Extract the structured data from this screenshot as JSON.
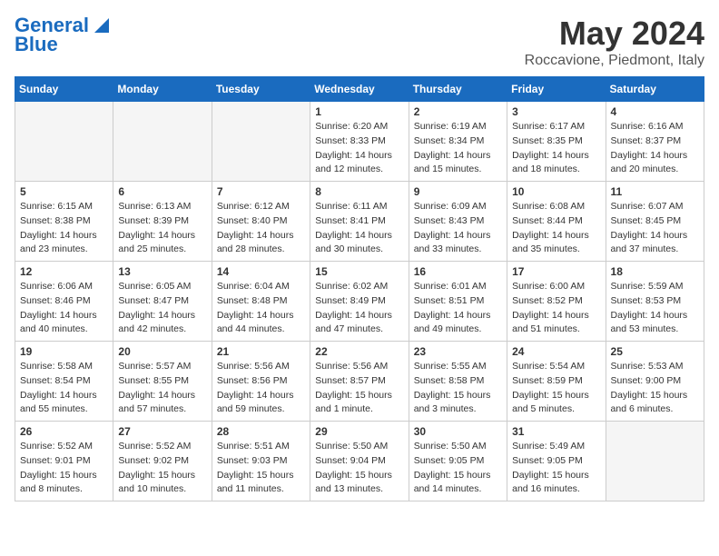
{
  "header": {
    "logo_line1": "General",
    "logo_line2": "Blue",
    "month_title": "May 2024",
    "location": "Roccavione, Piedmont, Italy"
  },
  "days_header": [
    "Sunday",
    "Monday",
    "Tuesday",
    "Wednesday",
    "Thursday",
    "Friday",
    "Saturday"
  ],
  "weeks": [
    [
      {
        "day": "",
        "info": ""
      },
      {
        "day": "",
        "info": ""
      },
      {
        "day": "",
        "info": ""
      },
      {
        "day": "1",
        "info": "Sunrise: 6:20 AM\nSunset: 8:33 PM\nDaylight: 14 hours\nand 12 minutes."
      },
      {
        "day": "2",
        "info": "Sunrise: 6:19 AM\nSunset: 8:34 PM\nDaylight: 14 hours\nand 15 minutes."
      },
      {
        "day": "3",
        "info": "Sunrise: 6:17 AM\nSunset: 8:35 PM\nDaylight: 14 hours\nand 18 minutes."
      },
      {
        "day": "4",
        "info": "Sunrise: 6:16 AM\nSunset: 8:37 PM\nDaylight: 14 hours\nand 20 minutes."
      }
    ],
    [
      {
        "day": "5",
        "info": "Sunrise: 6:15 AM\nSunset: 8:38 PM\nDaylight: 14 hours\nand 23 minutes."
      },
      {
        "day": "6",
        "info": "Sunrise: 6:13 AM\nSunset: 8:39 PM\nDaylight: 14 hours\nand 25 minutes."
      },
      {
        "day": "7",
        "info": "Sunrise: 6:12 AM\nSunset: 8:40 PM\nDaylight: 14 hours\nand 28 minutes."
      },
      {
        "day": "8",
        "info": "Sunrise: 6:11 AM\nSunset: 8:41 PM\nDaylight: 14 hours\nand 30 minutes."
      },
      {
        "day": "9",
        "info": "Sunrise: 6:09 AM\nSunset: 8:43 PM\nDaylight: 14 hours\nand 33 minutes."
      },
      {
        "day": "10",
        "info": "Sunrise: 6:08 AM\nSunset: 8:44 PM\nDaylight: 14 hours\nand 35 minutes."
      },
      {
        "day": "11",
        "info": "Sunrise: 6:07 AM\nSunset: 8:45 PM\nDaylight: 14 hours\nand 37 minutes."
      }
    ],
    [
      {
        "day": "12",
        "info": "Sunrise: 6:06 AM\nSunset: 8:46 PM\nDaylight: 14 hours\nand 40 minutes."
      },
      {
        "day": "13",
        "info": "Sunrise: 6:05 AM\nSunset: 8:47 PM\nDaylight: 14 hours\nand 42 minutes."
      },
      {
        "day": "14",
        "info": "Sunrise: 6:04 AM\nSunset: 8:48 PM\nDaylight: 14 hours\nand 44 minutes."
      },
      {
        "day": "15",
        "info": "Sunrise: 6:02 AM\nSunset: 8:49 PM\nDaylight: 14 hours\nand 47 minutes."
      },
      {
        "day": "16",
        "info": "Sunrise: 6:01 AM\nSunset: 8:51 PM\nDaylight: 14 hours\nand 49 minutes."
      },
      {
        "day": "17",
        "info": "Sunrise: 6:00 AM\nSunset: 8:52 PM\nDaylight: 14 hours\nand 51 minutes."
      },
      {
        "day": "18",
        "info": "Sunrise: 5:59 AM\nSunset: 8:53 PM\nDaylight: 14 hours\nand 53 minutes."
      }
    ],
    [
      {
        "day": "19",
        "info": "Sunrise: 5:58 AM\nSunset: 8:54 PM\nDaylight: 14 hours\nand 55 minutes."
      },
      {
        "day": "20",
        "info": "Sunrise: 5:57 AM\nSunset: 8:55 PM\nDaylight: 14 hours\nand 57 minutes."
      },
      {
        "day": "21",
        "info": "Sunrise: 5:56 AM\nSunset: 8:56 PM\nDaylight: 14 hours\nand 59 minutes."
      },
      {
        "day": "22",
        "info": "Sunrise: 5:56 AM\nSunset: 8:57 PM\nDaylight: 15 hours\nand 1 minute."
      },
      {
        "day": "23",
        "info": "Sunrise: 5:55 AM\nSunset: 8:58 PM\nDaylight: 15 hours\nand 3 minutes."
      },
      {
        "day": "24",
        "info": "Sunrise: 5:54 AM\nSunset: 8:59 PM\nDaylight: 15 hours\nand 5 minutes."
      },
      {
        "day": "25",
        "info": "Sunrise: 5:53 AM\nSunset: 9:00 PM\nDaylight: 15 hours\nand 6 minutes."
      }
    ],
    [
      {
        "day": "26",
        "info": "Sunrise: 5:52 AM\nSunset: 9:01 PM\nDaylight: 15 hours\nand 8 minutes."
      },
      {
        "day": "27",
        "info": "Sunrise: 5:52 AM\nSunset: 9:02 PM\nDaylight: 15 hours\nand 10 minutes."
      },
      {
        "day": "28",
        "info": "Sunrise: 5:51 AM\nSunset: 9:03 PM\nDaylight: 15 hours\nand 11 minutes."
      },
      {
        "day": "29",
        "info": "Sunrise: 5:50 AM\nSunset: 9:04 PM\nDaylight: 15 hours\nand 13 minutes."
      },
      {
        "day": "30",
        "info": "Sunrise: 5:50 AM\nSunset: 9:05 PM\nDaylight: 15 hours\nand 14 minutes."
      },
      {
        "day": "31",
        "info": "Sunrise: 5:49 AM\nSunset: 9:05 PM\nDaylight: 15 hours\nand 16 minutes."
      },
      {
        "day": "",
        "info": ""
      }
    ]
  ]
}
